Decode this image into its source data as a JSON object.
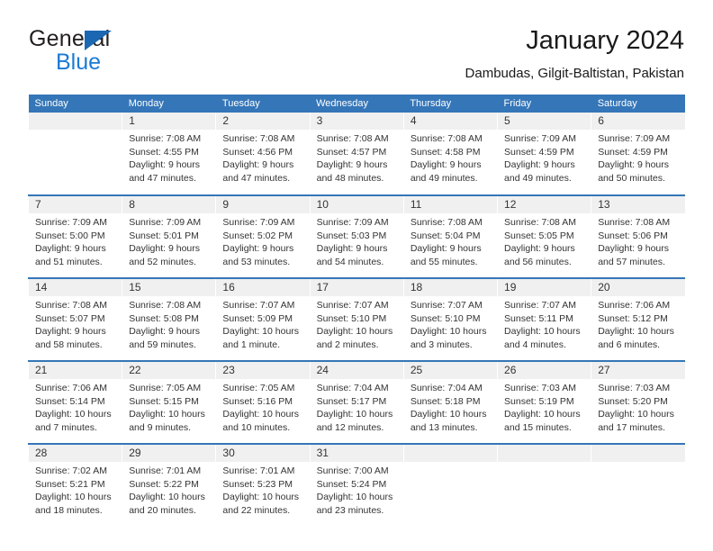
{
  "brand": {
    "name_part1": "General",
    "name_part2": "Blue",
    "accent_color": "#1b7ad4",
    "triangle_color": "#1b67b2"
  },
  "header": {
    "title": "January 2024",
    "subtitle": "Dambudas, Gilgit-Baltistan, Pakistan"
  },
  "calendar": {
    "header_bg": "#3576b8",
    "daynum_bg": "#f0f0f0",
    "weekday_headers": [
      "Sunday",
      "Monday",
      "Tuesday",
      "Wednesday",
      "Thursday",
      "Friday",
      "Saturday"
    ],
    "weeks": [
      [
        {
          "day": "",
          "sunrise": "",
          "sunset": "",
          "daylight_line1": "",
          "daylight_line2": ""
        },
        {
          "day": "1",
          "sunrise": "Sunrise: 7:08 AM",
          "sunset": "Sunset: 4:55 PM",
          "daylight_line1": "Daylight: 9 hours",
          "daylight_line2": "and 47 minutes."
        },
        {
          "day": "2",
          "sunrise": "Sunrise: 7:08 AM",
          "sunset": "Sunset: 4:56 PM",
          "daylight_line1": "Daylight: 9 hours",
          "daylight_line2": "and 47 minutes."
        },
        {
          "day": "3",
          "sunrise": "Sunrise: 7:08 AM",
          "sunset": "Sunset: 4:57 PM",
          "daylight_line1": "Daylight: 9 hours",
          "daylight_line2": "and 48 minutes."
        },
        {
          "day": "4",
          "sunrise": "Sunrise: 7:08 AM",
          "sunset": "Sunset: 4:58 PM",
          "daylight_line1": "Daylight: 9 hours",
          "daylight_line2": "and 49 minutes."
        },
        {
          "day": "5",
          "sunrise": "Sunrise: 7:09 AM",
          "sunset": "Sunset: 4:59 PM",
          "daylight_line1": "Daylight: 9 hours",
          "daylight_line2": "and 49 minutes."
        },
        {
          "day": "6",
          "sunrise": "Sunrise: 7:09 AM",
          "sunset": "Sunset: 4:59 PM",
          "daylight_line1": "Daylight: 9 hours",
          "daylight_line2": "and 50 minutes."
        }
      ],
      [
        {
          "day": "7",
          "sunrise": "Sunrise: 7:09 AM",
          "sunset": "Sunset: 5:00 PM",
          "daylight_line1": "Daylight: 9 hours",
          "daylight_line2": "and 51 minutes."
        },
        {
          "day": "8",
          "sunrise": "Sunrise: 7:09 AM",
          "sunset": "Sunset: 5:01 PM",
          "daylight_line1": "Daylight: 9 hours",
          "daylight_line2": "and 52 minutes."
        },
        {
          "day": "9",
          "sunrise": "Sunrise: 7:09 AM",
          "sunset": "Sunset: 5:02 PM",
          "daylight_line1": "Daylight: 9 hours",
          "daylight_line2": "and 53 minutes."
        },
        {
          "day": "10",
          "sunrise": "Sunrise: 7:09 AM",
          "sunset": "Sunset: 5:03 PM",
          "daylight_line1": "Daylight: 9 hours",
          "daylight_line2": "and 54 minutes."
        },
        {
          "day": "11",
          "sunrise": "Sunrise: 7:08 AM",
          "sunset": "Sunset: 5:04 PM",
          "daylight_line1": "Daylight: 9 hours",
          "daylight_line2": "and 55 minutes."
        },
        {
          "day": "12",
          "sunrise": "Sunrise: 7:08 AM",
          "sunset": "Sunset: 5:05 PM",
          "daylight_line1": "Daylight: 9 hours",
          "daylight_line2": "and 56 minutes."
        },
        {
          "day": "13",
          "sunrise": "Sunrise: 7:08 AM",
          "sunset": "Sunset: 5:06 PM",
          "daylight_line1": "Daylight: 9 hours",
          "daylight_line2": "and 57 minutes."
        }
      ],
      [
        {
          "day": "14",
          "sunrise": "Sunrise: 7:08 AM",
          "sunset": "Sunset: 5:07 PM",
          "daylight_line1": "Daylight: 9 hours",
          "daylight_line2": "and 58 minutes."
        },
        {
          "day": "15",
          "sunrise": "Sunrise: 7:08 AM",
          "sunset": "Sunset: 5:08 PM",
          "daylight_line1": "Daylight: 9 hours",
          "daylight_line2": "and 59 minutes."
        },
        {
          "day": "16",
          "sunrise": "Sunrise: 7:07 AM",
          "sunset": "Sunset: 5:09 PM",
          "daylight_line1": "Daylight: 10 hours",
          "daylight_line2": "and 1 minute."
        },
        {
          "day": "17",
          "sunrise": "Sunrise: 7:07 AM",
          "sunset": "Sunset: 5:10 PM",
          "daylight_line1": "Daylight: 10 hours",
          "daylight_line2": "and 2 minutes."
        },
        {
          "day": "18",
          "sunrise": "Sunrise: 7:07 AM",
          "sunset": "Sunset: 5:10 PM",
          "daylight_line1": "Daylight: 10 hours",
          "daylight_line2": "and 3 minutes."
        },
        {
          "day": "19",
          "sunrise": "Sunrise: 7:07 AM",
          "sunset": "Sunset: 5:11 PM",
          "daylight_line1": "Daylight: 10 hours",
          "daylight_line2": "and 4 minutes."
        },
        {
          "day": "20",
          "sunrise": "Sunrise: 7:06 AM",
          "sunset": "Sunset: 5:12 PM",
          "daylight_line1": "Daylight: 10 hours",
          "daylight_line2": "and 6 minutes."
        }
      ],
      [
        {
          "day": "21",
          "sunrise": "Sunrise: 7:06 AM",
          "sunset": "Sunset: 5:14 PM",
          "daylight_line1": "Daylight: 10 hours",
          "daylight_line2": "and 7 minutes."
        },
        {
          "day": "22",
          "sunrise": "Sunrise: 7:05 AM",
          "sunset": "Sunset: 5:15 PM",
          "daylight_line1": "Daylight: 10 hours",
          "daylight_line2": "and 9 minutes."
        },
        {
          "day": "23",
          "sunrise": "Sunrise: 7:05 AM",
          "sunset": "Sunset: 5:16 PM",
          "daylight_line1": "Daylight: 10 hours",
          "daylight_line2": "and 10 minutes."
        },
        {
          "day": "24",
          "sunrise": "Sunrise: 7:04 AM",
          "sunset": "Sunset: 5:17 PM",
          "daylight_line1": "Daylight: 10 hours",
          "daylight_line2": "and 12 minutes."
        },
        {
          "day": "25",
          "sunrise": "Sunrise: 7:04 AM",
          "sunset": "Sunset: 5:18 PM",
          "daylight_line1": "Daylight: 10 hours",
          "daylight_line2": "and 13 minutes."
        },
        {
          "day": "26",
          "sunrise": "Sunrise: 7:03 AM",
          "sunset": "Sunset: 5:19 PM",
          "daylight_line1": "Daylight: 10 hours",
          "daylight_line2": "and 15 minutes."
        },
        {
          "day": "27",
          "sunrise": "Sunrise: 7:03 AM",
          "sunset": "Sunset: 5:20 PM",
          "daylight_line1": "Daylight: 10 hours",
          "daylight_line2": "and 17 minutes."
        }
      ],
      [
        {
          "day": "28",
          "sunrise": "Sunrise: 7:02 AM",
          "sunset": "Sunset: 5:21 PM",
          "daylight_line1": "Daylight: 10 hours",
          "daylight_line2": "and 18 minutes."
        },
        {
          "day": "29",
          "sunrise": "Sunrise: 7:01 AM",
          "sunset": "Sunset: 5:22 PM",
          "daylight_line1": "Daylight: 10 hours",
          "daylight_line2": "and 20 minutes."
        },
        {
          "day": "30",
          "sunrise": "Sunrise: 7:01 AM",
          "sunset": "Sunset: 5:23 PM",
          "daylight_line1": "Daylight: 10 hours",
          "daylight_line2": "and 22 minutes."
        },
        {
          "day": "31",
          "sunrise": "Sunrise: 7:00 AM",
          "sunset": "Sunset: 5:24 PM",
          "daylight_line1": "Daylight: 10 hours",
          "daylight_line2": "and 23 minutes."
        },
        {
          "day": "",
          "sunrise": "",
          "sunset": "",
          "daylight_line1": "",
          "daylight_line2": ""
        },
        {
          "day": "",
          "sunrise": "",
          "sunset": "",
          "daylight_line1": "",
          "daylight_line2": ""
        },
        {
          "day": "",
          "sunrise": "",
          "sunset": "",
          "daylight_line1": "",
          "daylight_line2": ""
        }
      ]
    ]
  }
}
